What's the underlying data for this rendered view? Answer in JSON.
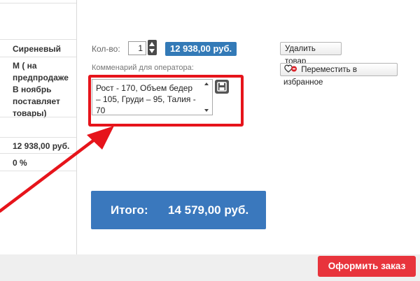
{
  "product": {
    "color": "Сиреневый",
    "size_lines": [
      "М ( на",
      "предпродаже",
      "В ноябрь",
      "поставляет",
      "товары)"
    ],
    "price": "12 938,00 руб.",
    "discount": "0 %"
  },
  "quantity": {
    "label": "Кол-во:",
    "value": "1"
  },
  "line_price": "12 938,00 руб.",
  "actions": {
    "remove": "Удалить товар",
    "favorite": "Переместить в избранное"
  },
  "comment": {
    "label": "Комменарий для оператора:",
    "value": "Рост - 170, Объем бедер – 105, Груди – 95, Талия - 70"
  },
  "total": {
    "label": "Итого:",
    "value": "14 579,00 руб."
  },
  "checkout": {
    "label": "Оформить заказ"
  },
  "colors": {
    "accent_blue": "#337ab7",
    "annotation_red": "#e6141b",
    "checkout_red": "#e8343c"
  },
  "icons": {
    "stepper": "up-down-arrows-icon",
    "save": "floppy-disk-icon",
    "favorite": "heart-icon"
  }
}
